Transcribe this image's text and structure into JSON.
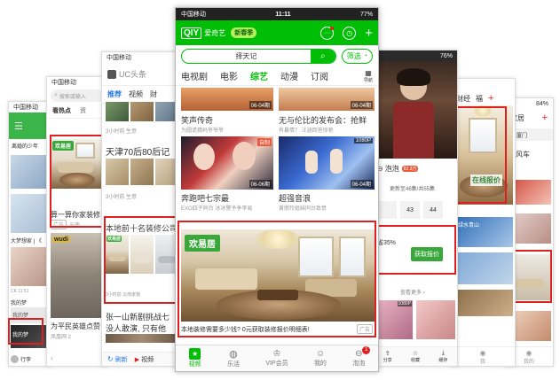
{
  "phone_a": {
    "carrier": "中国移动",
    "caption1": "离婚的少年",
    "caption2": "大梦想家 | 《",
    "caption3": "CK 11:51",
    "caption4": "我的梦",
    "caption5": "我的梦",
    "caption6": "我的梦",
    "bottom_user": "行李"
  },
  "phone_b": {
    "carrier": "中国移动",
    "search_placeholder": "搜索或输入",
    "tab": "看热点",
    "tab2": "资",
    "ad_logo": "欢易居",
    "title1": "算一算你家装修",
    "ad_tag": "广告",
    "ad_source": "云南",
    "title2": "为平民英雄点赞",
    "meta2": "凤凰网  2"
  },
  "phone_c": {
    "carrier": "中国移动",
    "app_name": "UC头条",
    "tabs": [
      "推荐",
      "视频",
      "财"
    ],
    "title1": "天津70后80后记忆",
    "meta1": "3小时前  生意",
    "title_ad": "本地前十名装修公司",
    "meta_ad": "3小时前  云南家装",
    "title3": "张一山新剧挑战七",
    "title3b": "没人敢演, 只有他",
    "meta3": "3小时前  ",
    "bottom": [
      "刷新",
      "视频"
    ],
    "ad_logo": "欢易居"
  },
  "phone_main": {
    "carrier": "中国移动",
    "time": "11:11",
    "battery": "77%",
    "app_name": "爱奇艺",
    "badge_text": "新春季",
    "search_value": "择天记",
    "filter_label": "筛选",
    "nav_tabs": [
      "电视剧",
      "电影",
      "综艺",
      "动漫",
      "订阅"
    ],
    "nav_more": "导航",
    "card1_title": "笑声传奇",
    "card1_sub": "为圆谎猜妈爷爷爷",
    "card1_ep": "06-04期",
    "card2_title": "无与伦比的发布会：抢鲜",
    "card2_sub": "有暴情？ 汪涵回答惊艳",
    "card2_ep": "06-04期",
    "card3_title": "奔跑吧七宗最",
    "card3_sub": "EXO四子同台 冰冰警予争李易",
    "card3_ep": "06-06期",
    "card3_tag": "自制",
    "card4_title": "超强音浪",
    "card4_sub": "黄丽玲姐妹同台致意",
    "card4_ep": "06-04期",
    "card4_tag": "1080P",
    "ad_logo": "欢易居",
    "ad_caption": "本地装修需要多少钱? 0元获取装修报价明细表!",
    "ad_tag": "广告",
    "bottom_tabs": [
      "视频",
      "乐活",
      "VIP会员",
      "我的",
      "泡泡"
    ],
    "bottom_badge": "1"
  },
  "phone_d": {
    "battery": "76%",
    "tab_label": "泡泡",
    "tab_badge": "82.3万",
    "update_text": "更新至46集/共55集",
    "ep_numbers": [
      "43",
      "44"
    ],
    "discount": "省35%",
    "cta": "获取报价",
    "see_more": "查看更多",
    "bottom": [
      "分享",
      "收藏",
      "缓存"
    ],
    "video_tag": "1080P"
  },
  "phone_e": {
    "tabs": [
      "财经",
      "福"
    ],
    "banner": "在线报价",
    "bottom": "我"
  },
  "phone_f": {
    "battery": "84%",
    "tab": "家居",
    "location": "厦门",
    "title": "顺风车",
    "bottom": "我的"
  }
}
